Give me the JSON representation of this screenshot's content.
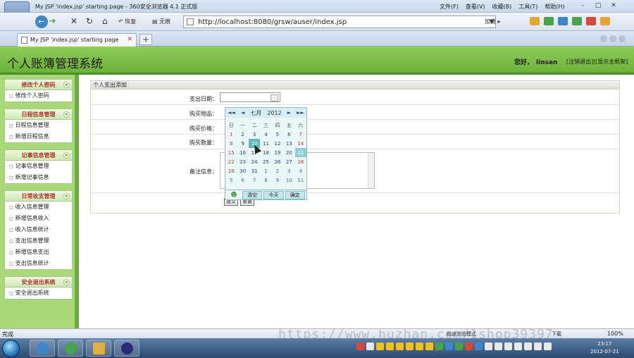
{
  "browser": {
    "window_title": "My JSP 'index.jsp' starting page - 360安全浏览器 4.1 正式版",
    "menu": [
      "文件(F)",
      "查看(V)",
      "收藏(B)",
      "工具(T)",
      "帮助(H)"
    ],
    "restore_label": "恢复",
    "trace_label": "无痕",
    "url": "http://localhost:8080/grsw/auser/index.jsp",
    "accelerate_label": "加速",
    "tab_label": "My JSP 'index.jsp' starting page",
    "new_tab": "+"
  },
  "app": {
    "title": "个人账簿管理系统",
    "greeting": "您好，",
    "username": "linsan",
    "logout_link": "[注销退出]",
    "home_link": "[显示主框架]"
  },
  "sidebar": {
    "groups": [
      {
        "title": "修改个人密码",
        "toggle": "«",
        "items": [
          "修改个人密码"
        ]
      },
      {
        "title": "日程信息管理",
        "toggle": "«",
        "items": [
          "日程信息管理",
          "新增日程信息"
        ]
      },
      {
        "title": "记事信息管理",
        "toggle": "«",
        "items": [
          "记事信息管理",
          "新增记事信息"
        ]
      },
      {
        "title": "日常收支管理",
        "toggle": "«",
        "items": [
          "收入信息管理",
          "新增信息收入",
          "收入信息统计",
          "支出信息管理",
          "新增信息支出",
          "支出信息统计"
        ]
      },
      {
        "title": "安全退出系统",
        "toggle": "«",
        "items": [
          "安全退出系统"
        ]
      }
    ]
  },
  "form": {
    "panel_title": "个人支出添加",
    "labels": {
      "date": "支出日期：",
      "item": "购买物品：",
      "price": "购买价格：",
      "qty": "购买数量：",
      "notes": "备注信息："
    },
    "submit": "提交",
    "reset": "重置"
  },
  "calendar": {
    "prev_year": "◄◄",
    "prev_month": "◄",
    "month": "七月",
    "year": "2012",
    "next_month": "►",
    "next_year": "►►",
    "weekdays": [
      "日",
      "一",
      "二",
      "三",
      "四",
      "五",
      "六"
    ],
    "weeks": [
      [
        "1",
        "2",
        "3",
        "4",
        "5",
        "6",
        "7"
      ],
      [
        "8",
        "9",
        "10",
        "11",
        "12",
        "13",
        "14"
      ],
      [
        "15",
        "16",
        "17",
        "18",
        "19",
        "20",
        "21"
      ],
      [
        "22",
        "23",
        "24",
        "25",
        "26",
        "27",
        "28"
      ],
      [
        "29",
        "30",
        "31",
        "1",
        "2",
        "3",
        "4"
      ],
      [
        "5",
        "6",
        "7",
        "8",
        "9",
        "10",
        "11"
      ]
    ],
    "selected_day": "10",
    "today_day": "21",
    "clear": "清空",
    "today": "今天",
    "confirm": "确定"
  },
  "status": {
    "text": "完成",
    "mode": "极速浏览模式",
    "download": "下载",
    "zoom": "100%",
    "watermark": "https://www.huzhan.com/1shop39397"
  },
  "taskbar": {
    "time": "23:17",
    "date": "2012-07-21"
  },
  "colors": {
    "header_green": "#8fcd58",
    "sidebar_green": "#a8d878",
    "group_title_red": "#b0322b",
    "calendar_selected": "#5fb8bd"
  }
}
